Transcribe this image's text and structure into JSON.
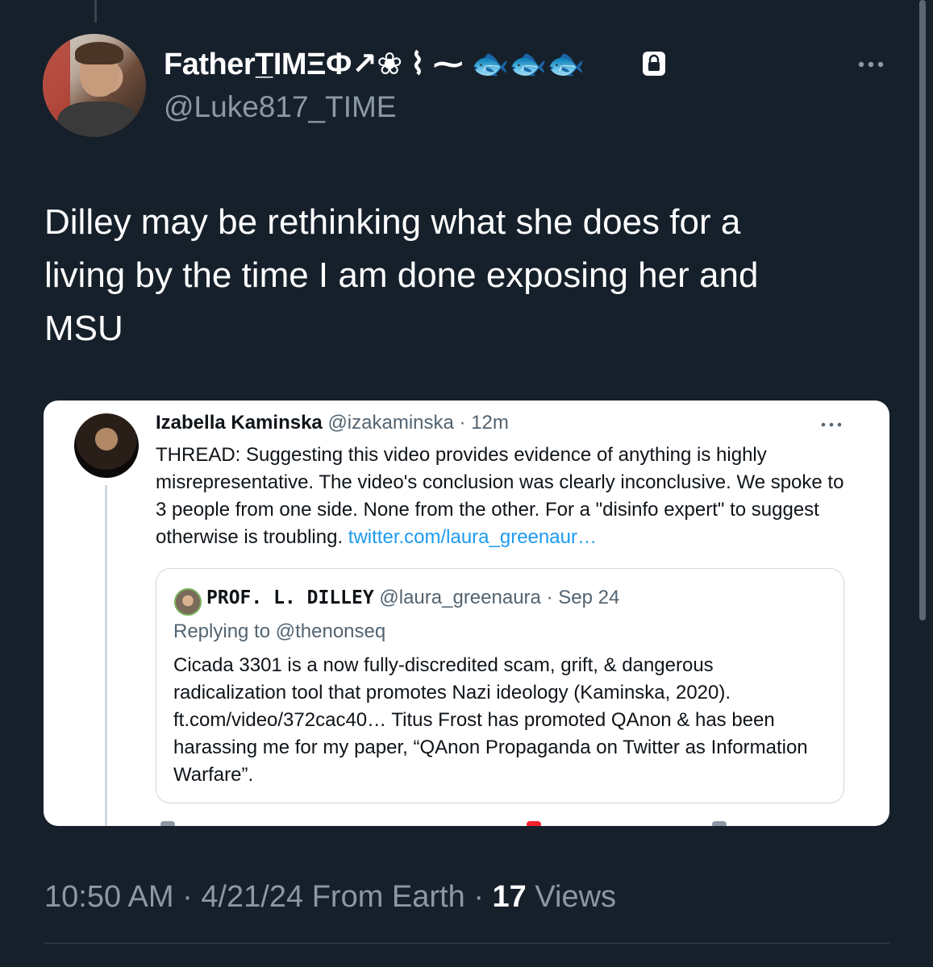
{
  "tweet": {
    "display_name": "FatherT̲IMΞФ↗❀ ⌇ ⁓ 🐟🐟🐟",
    "handle": "@Luke817_TIME",
    "text": "Dilley may be rethinking what she does for a\nliving by the time I am done exposing her and\nMSU",
    "time": "10:50 AM",
    "date": "4/21/24",
    "source": "From Earth",
    "views_count": "17",
    "views_label": "Views",
    "separator": "·"
  },
  "embedded": {
    "name": "Izabella Kaminska",
    "handle": "@izakaminska",
    "time": "· 12m",
    "text": "THREAD: Suggesting this video provides evidence of anything is highly misrepresentative. The video's conclusion was clearly inconclusive. We spoke to 3 people from one side. None from the other. For a \"disinfo expert\" to suggest otherwise is troubling.",
    "link": "twitter.com/laura_greenaur…",
    "quote": {
      "name": "PROF. L. DILLEY",
      "handle": "@laura_greenaura",
      "time": "· Sep 24",
      "replying_to": "Replying to @thenonseq",
      "text": "Cicada 3301 is a now fully-discredited scam, grift, & dangerous radicalization tool that promotes Nazi ideology (Kaminska, 2020). ft.com/video/372cac40… Titus Frost has promoted QAnon & has been harassing me for my paper, “QAnon Propaganda on Twitter as Information Warfare”."
    }
  },
  "icons": {
    "lock": "lock-icon",
    "more": "more-horizontal-icon"
  },
  "colors": {
    "background": "#15202b",
    "text_primary": "#ffffff",
    "text_secondary": "#8b98a5",
    "link": "#1d9bf0"
  }
}
